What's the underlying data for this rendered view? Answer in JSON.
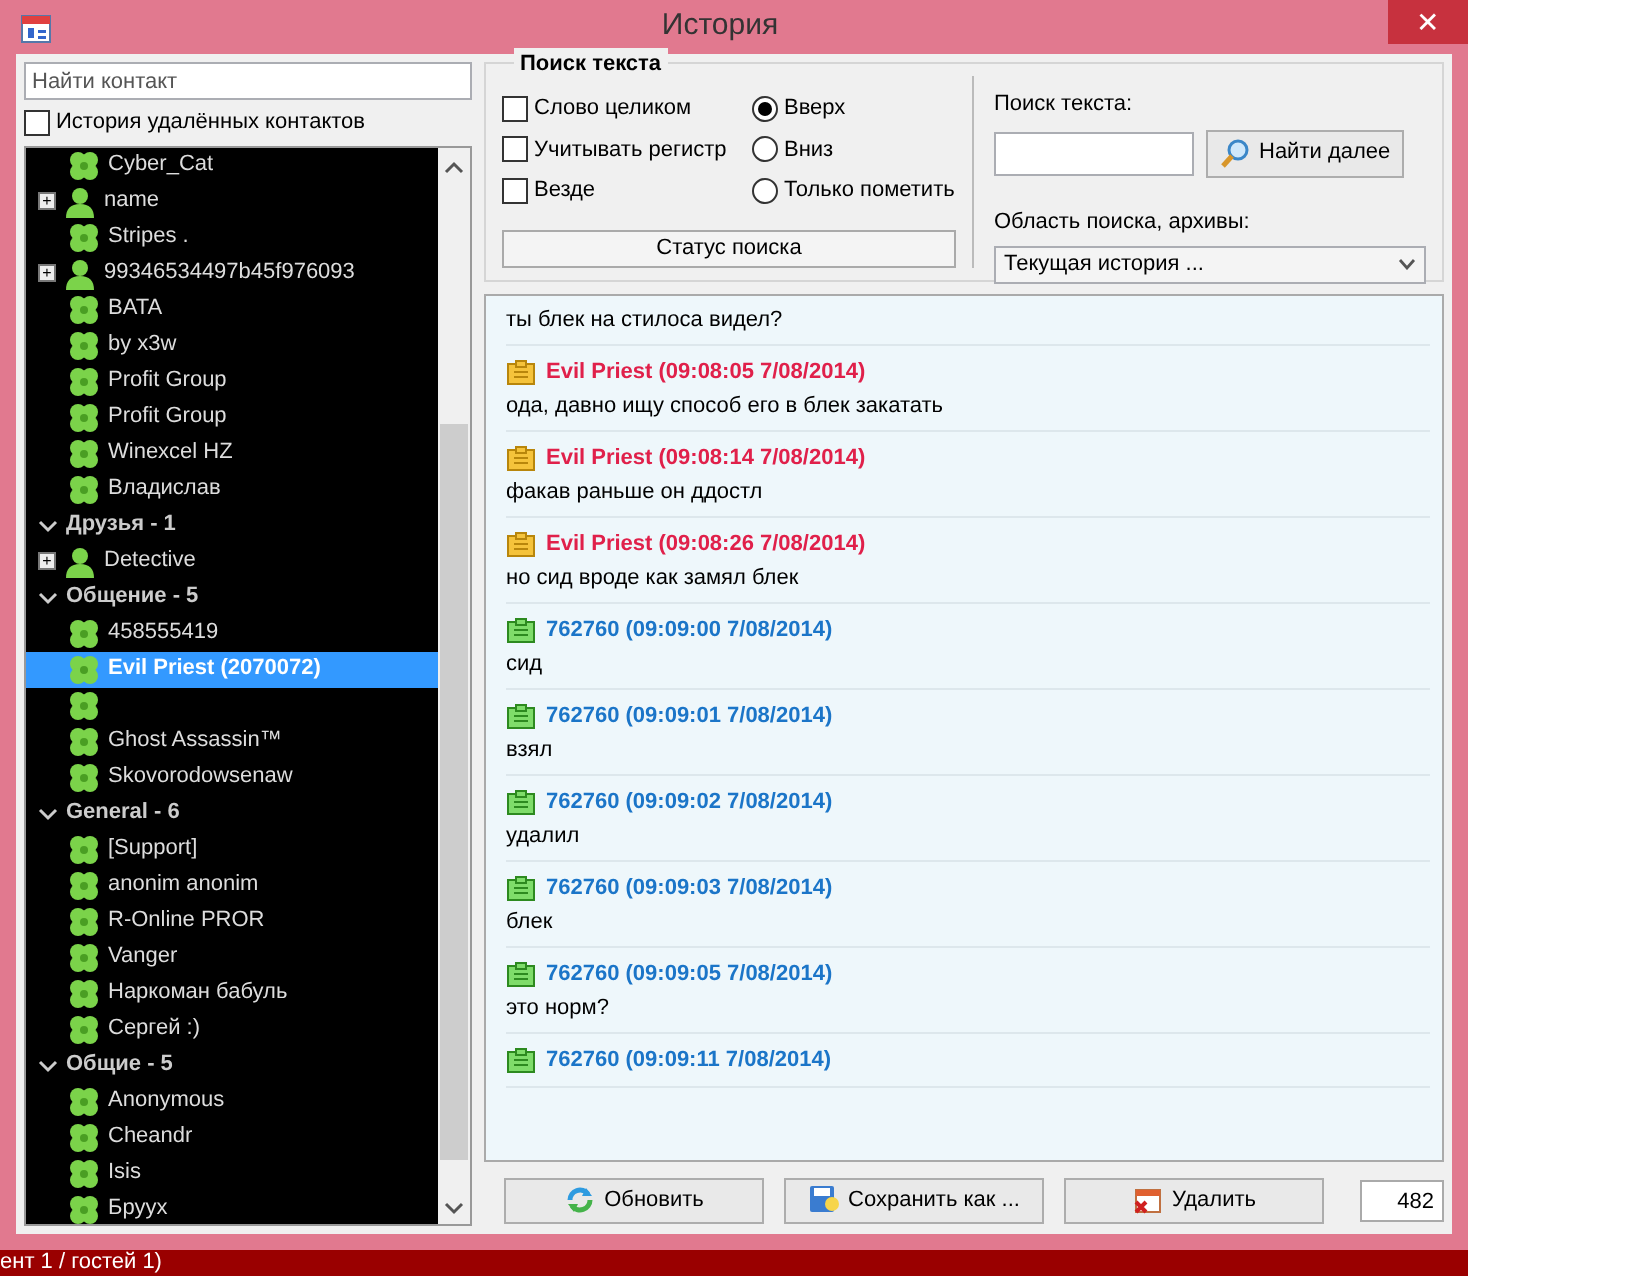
{
  "window": {
    "title": "История",
    "close": "✕"
  },
  "contact_search": {
    "placeholder": "Найти контакт"
  },
  "deleted_history": {
    "label": "История удалённых контактов",
    "checked": false
  },
  "tree": [
    {
      "kind": "contact",
      "name": "Cyber_Cat",
      "selected": false
    },
    {
      "kind": "person",
      "expander": "+",
      "name": "name",
      "selected": false
    },
    {
      "kind": "contact",
      "name": "Stripes .",
      "selected": false
    },
    {
      "kind": "person",
      "expander": "+",
      "name": "99346534497b45f976093",
      "selected": false
    },
    {
      "kind": "contact",
      "name": "BATA",
      "selected": false
    },
    {
      "kind": "contact",
      "name": "by x3w",
      "selected": false
    },
    {
      "kind": "contact",
      "name": "Profit Group",
      "selected": false
    },
    {
      "kind": "contact",
      "name": "Profit Group",
      "selected": false
    },
    {
      "kind": "contact",
      "name": "Winexcel HZ",
      "selected": false
    },
    {
      "kind": "contact",
      "name": "Владислав",
      "selected": false
    },
    {
      "kind": "group",
      "name": "Друзья - 1",
      "expanded": true,
      "children": [
        {
          "kind": "person",
          "expander": "+",
          "name": "Detective",
          "selected": false
        }
      ]
    },
    {
      "kind": "group",
      "name": "Общение - 5",
      "expanded": true,
      "children": [
        {
          "kind": "contact",
          "name": "458555419",
          "selected": false
        },
        {
          "kind": "contact",
          "name": "Evil Priest (2070072)",
          "selected": true
        },
        {
          "kind": "contact",
          "selected": false
        },
        {
          "kind": "contact",
          "name": "Ghost Assassin™",
          "selected": false
        },
        {
          "kind": "contact",
          "name": "Skovorodowsenaw",
          "selected": false
        }
      ]
    },
    {
      "kind": "group",
      "name": "General - 6",
      "expanded": true,
      "children": [
        {
          "kind": "contact",
          "name": "[Support]",
          "selected": false
        },
        {
          "kind": "contact",
          "name": "anonim anonim",
          "selected": false
        },
        {
          "kind": "contact",
          "name": "R-Online PROR",
          "selected": false
        },
        {
          "kind": "contact",
          "name": "Vanger",
          "selected": false
        },
        {
          "kind": "contact",
          "name": "Наркоман бабуль",
          "selected": false
        },
        {
          "kind": "contact",
          "name": "Сергей :)",
          "selected": false
        }
      ]
    },
    {
      "kind": "group",
      "name": "Общие - 5",
      "expanded": true,
      "children": [
        {
          "kind": "contact",
          "name": "Anonymous",
          "selected": false
        },
        {
          "kind": "contact",
          "name": "Cheandr",
          "selected": false
        },
        {
          "kind": "contact",
          "name": "Isis",
          "selected": false
        },
        {
          "kind": "contact",
          "name": "Бруух",
          "selected": false
        }
      ]
    }
  ],
  "search_panel": {
    "title": "Поиск текста",
    "options": [
      {
        "label": "Слово целиком",
        "checked": false
      },
      {
        "label": "Учитывать регистр",
        "checked": false
      },
      {
        "label": "Везде",
        "checked": false
      }
    ],
    "directions": [
      {
        "label": "Вверх",
        "selected": true
      },
      {
        "label": "Вниз",
        "selected": false
      },
      {
        "label": "Только пометить",
        "selected": false
      }
    ],
    "status": "Статус поиска",
    "text_label": "Поиск текста:",
    "find_button": "Найти далее",
    "scope_label": "Область поиска, архивы:",
    "scope_value": "Текущая история ..."
  },
  "messages": [
    {
      "kind": "incoming",
      "text": "ты блек на стилоса видел?"
    },
    {
      "kind": "incoming",
      "header": "Evil Priest (09:08:05 7/08/2014)",
      "text": "ода, давно ищу способ его в блек закатать"
    },
    {
      "kind": "incoming",
      "header": "Evil Priest (09:08:14 7/08/2014)",
      "text": "факав раньше он ддостл"
    },
    {
      "kind": "incoming",
      "header": "Evil Priest (09:08:26 7/08/2014)",
      "text": "но сид вроде как замял блек"
    },
    {
      "kind": "outgoing",
      "header": "762760 (09:09:00 7/08/2014)",
      "text": "сид"
    },
    {
      "kind": "outgoing",
      "header": "762760 (09:09:01 7/08/2014)",
      "text": "взял"
    },
    {
      "kind": "outgoing",
      "header": "762760 (09:09:02 7/08/2014)",
      "text": "удалил"
    },
    {
      "kind": "outgoing",
      "header": "762760 (09:09:03 7/08/2014)",
      "text": "блек"
    },
    {
      "kind": "outgoing",
      "header": "762760 (09:09:05 7/08/2014)",
      "text": "это норм?"
    },
    {
      "kind": "outgoing",
      "header": "762760 (09:09:11 7/08/2014)"
    }
  ],
  "buttons": [
    {
      "kind": "refresh",
      "label": "Обновить"
    },
    {
      "kind": "save",
      "label": "Сохранить как ..."
    },
    {
      "kind": "delete",
      "label": "Удалить"
    }
  ],
  "count": "482",
  "taskbar_text": "ент 1 / гостей 1)"
}
